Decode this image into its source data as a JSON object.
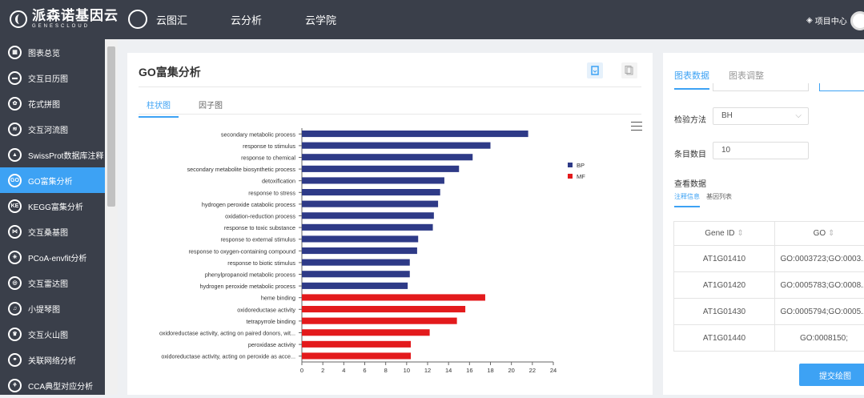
{
  "brand": {
    "name": "派森诺基因云",
    "sub": "GENESCLOUD"
  },
  "nav": [
    "云图汇",
    "云分析",
    "云学院"
  ],
  "project_center": "项目中心",
  "sidebar": [
    {
      "label": "图表总览",
      "icon": "grid-icon"
    },
    {
      "label": "交互日历图",
      "icon": "calendar-icon"
    },
    {
      "label": "花式拼图",
      "icon": "puzzle-icon"
    },
    {
      "label": "交互河流图",
      "icon": "river-icon"
    },
    {
      "label": "SwissProt数据库注释",
      "icon": "triangle-icon"
    },
    {
      "label": "GO富集分析",
      "icon": "go-icon"
    },
    {
      "label": "KEGG富集分析",
      "icon": "kegg-icon"
    },
    {
      "label": "交互桑基图",
      "icon": "sankey-icon"
    },
    {
      "label": "PCoA-envfit分析",
      "icon": "pcoa-icon"
    },
    {
      "label": "交互雷达图",
      "icon": "radar-icon"
    },
    {
      "label": "小提琴图",
      "icon": "violin-icon"
    },
    {
      "label": "交互火山图",
      "icon": "volcano-icon"
    },
    {
      "label": "关联网络分析",
      "icon": "network-icon"
    },
    {
      "label": "CCA典型对应分析",
      "icon": "cca-icon"
    }
  ],
  "sidebar_active": 5,
  "card": {
    "title": "GO富集分析",
    "tabs": [
      "柱状图",
      "因子图"
    ]
  },
  "chart_data": {
    "type": "bar",
    "orientation": "horizontal",
    "categories": [
      "secondary metabolic process",
      "response to stimulus",
      "response to chemical",
      "secondary metabolite biosynthetic process",
      "detoxification",
      "response to stress",
      "hydrogen peroxide catabolic process",
      "oxidation-reduction process",
      "response to toxic substance",
      "response to external stimulus",
      "response to oxygen-containing compound",
      "response to biotic stimulus",
      "phenylpropanoid metabolic process",
      "hydrogen peroxide metabolic process",
      "heme binding",
      "oxidoreductase activity",
      "tetrapyrrole binding",
      "oxidoreductase activity, acting on paired donors, wit...",
      "peroxidase activity",
      "oxidoreductase activity, acting on peroxide as acce..."
    ],
    "values": [
      21.6,
      18.0,
      16.3,
      15.0,
      13.6,
      13.2,
      13.0,
      12.6,
      12.5,
      11.1,
      11.0,
      10.3,
      10.3,
      10.1,
      17.5,
      15.6,
      14.8,
      12.2,
      10.4,
      10.4
    ],
    "groups": [
      "BP",
      "BP",
      "BP",
      "BP",
      "BP",
      "BP",
      "BP",
      "BP",
      "BP",
      "BP",
      "BP",
      "BP",
      "BP",
      "BP",
      "MF",
      "MF",
      "MF",
      "MF",
      "MF",
      "MF"
    ],
    "legend": [
      {
        "name": "BP",
        "color": "#2e3a87"
      },
      {
        "name": "MF",
        "color": "#e31a1c"
      }
    ],
    "xticks": [
      0,
      2,
      4,
      6,
      8,
      10,
      12,
      14,
      16,
      18,
      20,
      22,
      24
    ],
    "xlim": [
      0,
      24
    ],
    "legend_position": "top-right"
  },
  "panel": {
    "tabs": [
      "图表数据",
      "图表调整"
    ],
    "method_label": "检验方法",
    "method_value": "BH",
    "count_label": "条目数目",
    "count_value": "10",
    "view_label": "查看数据",
    "subtabs": [
      "注释信息",
      "基因列表"
    ],
    "table": {
      "headers": [
        "Gene ID",
        "GO"
      ],
      "rows": [
        [
          "AT1G01410",
          "GO:0003723;GO:0003..."
        ],
        [
          "AT1G01420",
          "GO:0005783;GO:0008..."
        ],
        [
          "AT1G01430",
          "GO:0005794;GO:0005..."
        ],
        [
          "AT1G01440",
          "GO:0008150;"
        ]
      ]
    },
    "submit": "提交绘图"
  }
}
